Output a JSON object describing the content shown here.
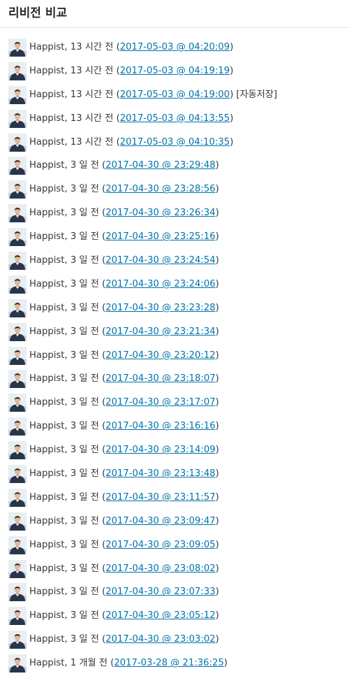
{
  "header": {
    "title": "리비전 비교"
  },
  "revisions": [
    {
      "meta": "Happist, 13 시간 전",
      "date": "2017-05-03 @ 04:20:09",
      "note": ""
    },
    {
      "meta": "Happist, 13 시간 전",
      "date": "2017-05-03 @ 04:19:19",
      "note": ""
    },
    {
      "meta": "Happist, 13 시간 전",
      "date": "2017-05-03 @ 04:19:00",
      "note": "[자동저장]"
    },
    {
      "meta": "Happist, 13 시간 전",
      "date": "2017-05-03 @ 04:13:55",
      "note": ""
    },
    {
      "meta": "Happist, 13 시간 전",
      "date": "2017-05-03 @ 04:10:35",
      "note": ""
    },
    {
      "meta": "Happist, 3 일 전",
      "date": "2017-04-30 @ 23:29:48",
      "note": ""
    },
    {
      "meta": "Happist, 3 일 전",
      "date": "2017-04-30 @ 23:28:56",
      "note": ""
    },
    {
      "meta": "Happist, 3 일 전",
      "date": "2017-04-30 @ 23:26:34",
      "note": ""
    },
    {
      "meta": "Happist, 3 일 전",
      "date": "2017-04-30 @ 23:25:16",
      "note": ""
    },
    {
      "meta": "Happist, 3 일 전",
      "date": "2017-04-30 @ 23:24:54",
      "note": ""
    },
    {
      "meta": "Happist, 3 일 전",
      "date": "2017-04-30 @ 23:24:06",
      "note": ""
    },
    {
      "meta": "Happist, 3 일 전",
      "date": "2017-04-30 @ 23:23:28",
      "note": ""
    },
    {
      "meta": "Happist, 3 일 전",
      "date": "2017-04-30 @ 23:21:34",
      "note": ""
    },
    {
      "meta": "Happist, 3 일 전",
      "date": "2017-04-30 @ 23:20:12",
      "note": ""
    },
    {
      "meta": "Happist, 3 일 전",
      "date": "2017-04-30 @ 23:18:07",
      "note": ""
    },
    {
      "meta": "Happist, 3 일 전",
      "date": "2017-04-30 @ 23:17:07",
      "note": ""
    },
    {
      "meta": "Happist, 3 일 전",
      "date": "2017-04-30 @ 23:16:16",
      "note": ""
    },
    {
      "meta": "Happist, 3 일 전",
      "date": "2017-04-30 @ 23:14:09",
      "note": ""
    },
    {
      "meta": "Happist, 3 일 전",
      "date": "2017-04-30 @ 23:13:48",
      "note": ""
    },
    {
      "meta": "Happist, 3 일 전",
      "date": "2017-04-30 @ 23:11:57",
      "note": ""
    },
    {
      "meta": "Happist, 3 일 전",
      "date": "2017-04-30 @ 23:09:47",
      "note": ""
    },
    {
      "meta": "Happist, 3 일 전",
      "date": "2017-04-30 @ 23:09:05",
      "note": ""
    },
    {
      "meta": "Happist, 3 일 전",
      "date": "2017-04-30 @ 23:08:02",
      "note": ""
    },
    {
      "meta": "Happist, 3 일 전",
      "date": "2017-04-30 @ 23:07:33",
      "note": ""
    },
    {
      "meta": "Happist, 3 일 전",
      "date": "2017-04-30 @ 23:05:12",
      "note": ""
    },
    {
      "meta": "Happist, 3 일 전",
      "date": "2017-04-30 @ 23:03:02",
      "note": ""
    },
    {
      "meta": "Happist, 1 개월 전",
      "date": "2017-03-28 @ 21:36:25",
      "note": ""
    }
  ]
}
